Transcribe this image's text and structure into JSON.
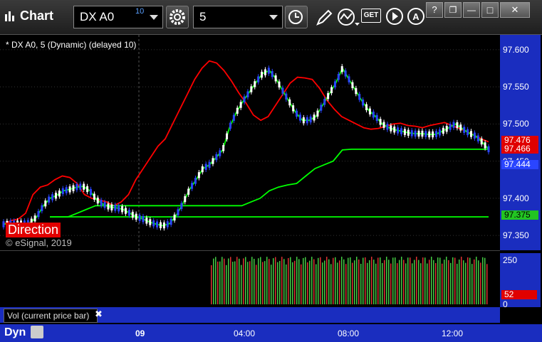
{
  "window": {
    "title": "Chart",
    "symbol": "DX A0",
    "symbol_superscript": "10",
    "interval": "5",
    "buttons": {
      "help": "?",
      "restore": "❐",
      "minimize": "—",
      "maximize": "□",
      "close": "✕",
      "get_label": "GET",
      "a_label": "A"
    }
  },
  "chart": {
    "study_label": "* DX A0, 5 (Dynamic) (delayed 10)",
    "copyright": "© eSignal, 2019",
    "direction_label": "Direction",
    "price_labels": [
      "97.600",
      "97.550",
      "97.500",
      "97.450",
      "97.400",
      "97.350"
    ],
    "price_tags": {
      "red1": "97.476",
      "red2": "97.466",
      "blue": "97.444",
      "green": "97.375"
    },
    "vol_labels": {
      "top": "250",
      "tag": "52",
      "zero": "0"
    },
    "vol_study": "Vol (current price bar)",
    "close_icon": "✖",
    "time_labels": [
      "09",
      "04:00",
      "08:00",
      "12:00"
    ],
    "dyn_label": "Dyn",
    "colors": {
      "up": "#ffffff",
      "down": "#2a45ff",
      "fast_ma": "#ff0000",
      "slow_ma": "#00ff00",
      "axis_bg": "#1a2dbf"
    }
  },
  "chart_data": {
    "type": "line",
    "price_range": [
      97.33,
      97.62
    ],
    "series": [
      {
        "values": [
          97.365,
          97.37,
          97.372,
          97.38,
          97.405,
          97.415,
          97.418,
          97.425,
          97.43,
          97.428,
          97.42,
          97.405,
          97.4,
          97.398,
          97.395,
          97.39,
          97.395,
          97.405,
          97.425,
          97.44,
          97.455,
          97.47,
          97.48,
          97.5,
          97.52,
          97.54,
          97.56,
          97.575,
          97.585,
          97.582,
          97.572,
          97.558,
          97.542,
          97.528,
          97.512,
          97.505,
          97.51,
          97.525,
          97.54,
          97.555,
          97.563,
          97.562,
          97.56,
          97.548,
          97.532,
          97.52,
          97.51,
          97.505,
          97.5,
          97.495,
          97.493,
          97.494,
          97.497,
          97.5,
          97.501,
          97.498,
          97.497,
          97.495,
          97.498,
          97.5,
          97.502,
          97.498,
          97.494,
          97.49,
          97.485,
          97.48,
          97.476
        ]
      },
      {
        "values": [
          97.365,
          97.366,
          97.366,
          97.366,
          97.367,
          97.375,
          97.39,
          97.4,
          97.404,
          97.41,
          97.412,
          97.415,
          97.416,
          97.41,
          97.398,
          97.392,
          97.388,
          97.387,
          97.385,
          97.38,
          97.375,
          97.372,
          97.368,
          97.365,
          97.363,
          97.366,
          97.377,
          97.393,
          97.412,
          97.425,
          97.44,
          97.445,
          97.455,
          97.465,
          97.495,
          97.515,
          97.53,
          97.543,
          97.556,
          97.568,
          97.572,
          97.561,
          97.545,
          97.53,
          97.515,
          97.505,
          97.505,
          97.51,
          97.525,
          97.54,
          97.555,
          97.575,
          97.56,
          97.545,
          97.53,
          97.518,
          97.51,
          97.5,
          97.495,
          97.492,
          97.49,
          97.488,
          97.487,
          97.487,
          97.486,
          97.486,
          97.49,
          97.495,
          97.5,
          97.494,
          97.488,
          97.484,
          97.476,
          97.466
        ]
      },
      {
        "values": [
          97.375,
          97.375,
          97.375,
          97.38,
          97.385,
          97.39,
          97.39,
          97.39,
          97.39,
          97.39,
          97.39,
          97.39,
          97.39,
          97.39,
          97.39,
          97.39,
          97.39,
          97.39,
          97.39,
          97.39,
          97.39,
          97.39,
          97.395,
          97.4,
          97.41,
          97.415,
          97.418,
          97.42,
          97.43,
          97.44,
          97.445,
          97.45,
          97.465,
          97.466,
          97.466,
          97.466,
          97.466,
          97.466,
          97.466,
          97.466,
          97.466,
          97.466,
          97.466,
          97.466,
          97.466,
          97.466,
          97.466,
          97.466,
          97.466
        ]
      },
      {
        "values": [
          97.375,
          97.375,
          97.375,
          97.375,
          97.375,
          97.375,
          97.375,
          97.375,
          97.375
        ]
      }
    ]
  }
}
